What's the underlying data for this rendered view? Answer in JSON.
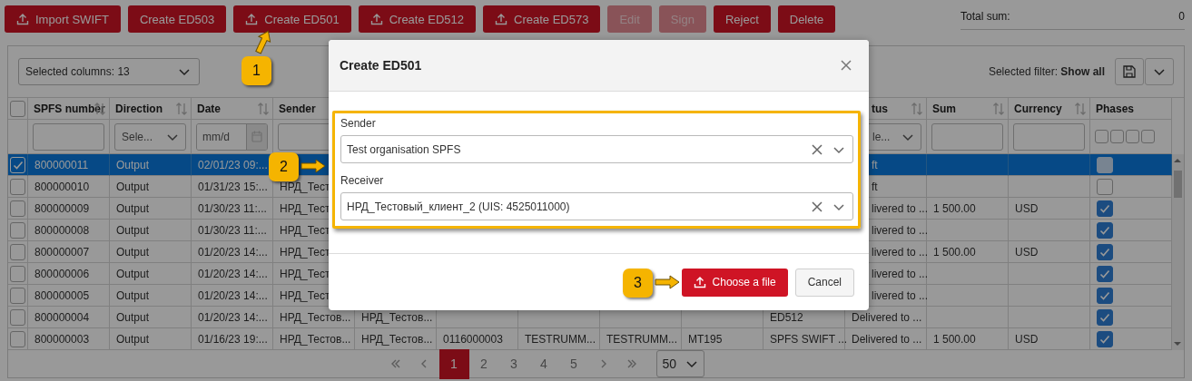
{
  "toolbar": {
    "buttons": [
      {
        "label": "Import SWIFT",
        "icon": true,
        "disabled": false
      },
      {
        "label": "Create ED503",
        "icon": false,
        "disabled": false
      },
      {
        "label": "Create ED501",
        "icon": true,
        "disabled": false
      },
      {
        "label": "Create ED512",
        "icon": true,
        "disabled": false
      },
      {
        "label": "Create ED573",
        "icon": true,
        "disabled": false
      },
      {
        "label": "Edit",
        "icon": false,
        "disabled": true
      },
      {
        "label": "Sign",
        "icon": false,
        "disabled": true
      },
      {
        "label": "Reject",
        "icon": false,
        "disabled": false
      },
      {
        "label": "Delete",
        "icon": false,
        "disabled": false
      }
    ],
    "total_sum": {
      "label": "Total sum:",
      "value": "0"
    }
  },
  "grid_controls": {
    "selected_columns": "Selected columns: 13",
    "selected_filter": "Selected filter: **Show all**"
  },
  "table": {
    "all_checked": false,
    "columns": [
      {
        "label": "SPFS number",
        "sortable": true,
        "filter": {
          "kind": "text"
        }
      },
      {
        "label": "Direction",
        "sortable": true,
        "filter": {
          "kind": "select",
          "value": "Sele..."
        }
      },
      {
        "label": "Date",
        "sortable": true,
        "filter": {
          "kind": "date",
          "placeholder": "mm/d"
        }
      },
      {
        "label": "Sender",
        "filter": {
          "kind": "text"
        }
      },
      {},
      {},
      {},
      {},
      {},
      {},
      {
        "label": "tus",
        "sortable": true,
        "filter": {
          "kind": "select",
          "value": "le..."
        }
      },
      {
        "label": "Sum",
        "sortable": true,
        "filter": {
          "kind": "text"
        }
      },
      {
        "label": "Currency",
        "sortable": true,
        "filter": {
          "kind": "text"
        }
      },
      {
        "label": "Phases",
        "sortable": false,
        "filter": {
          "kind": "phases",
          "boxes": [
            {
              "checked": false
            },
            {
              "checked": false
            },
            {
              "checked": false
            },
            {
              "checked": false
            }
          ]
        }
      }
    ],
    "rows": [
      {
        "selected": true,
        "checked": true,
        "phase_checked": false,
        "cells": [
          "800000011",
          "Output",
          "02/01/23 09:...",
          null,
          null,
          null,
          null,
          null,
          null,
          null,
          "ft",
          null,
          null
        ]
      },
      {
        "selected": false,
        "checked": false,
        "phase_checked": false,
        "cells": [
          "800000010",
          "Output",
          "01/31/23 15:...",
          "НРД_Тест",
          null,
          null,
          null,
          null,
          null,
          null,
          "ft",
          null,
          null
        ]
      },
      {
        "selected": false,
        "checked": false,
        "phase_checked": true,
        "cells": [
          "800000009",
          "Output",
          "01/30/23 11:...",
          "НРД_Тест",
          null,
          null,
          null,
          null,
          null,
          null,
          "livered to ...",
          "1 500.00",
          "USD"
        ]
      },
      {
        "selected": false,
        "checked": false,
        "phase_checked": true,
        "cells": [
          "800000008",
          "Output",
          "01/30/23 11:...",
          "НРД_Тест",
          null,
          null,
          null,
          null,
          null,
          null,
          "livered to ...",
          null,
          null
        ]
      },
      {
        "selected": false,
        "checked": false,
        "phase_checked": true,
        "cells": [
          "800000007",
          "Output",
          "01/20/23 14:...",
          "НРД_Тест",
          null,
          null,
          null,
          null,
          null,
          null,
          "livered to ...",
          "1 500.00",
          "USD"
        ]
      },
      {
        "selected": false,
        "checked": false,
        "phase_checked": true,
        "cells": [
          "800000006",
          "Output",
          "01/20/23 14:...",
          "НРД_Тест",
          null,
          null,
          null,
          null,
          null,
          null,
          "livered to ...",
          null,
          null
        ]
      },
      {
        "selected": false,
        "checked": false,
        "phase_checked": true,
        "cells": [
          "800000005",
          "Output",
          "01/20/23 14:...",
          "НРД_Тест",
          null,
          null,
          null,
          null,
          null,
          null,
          "livered to ...",
          null,
          null
        ]
      },
      {
        "selected": false,
        "checked": false,
        "phase_checked": true,
        "cells": [
          "800000004",
          "Output",
          "01/20/23 14:...",
          "НРД_Тестов...",
          "НРД_Тестов...",
          null,
          null,
          null,
          null,
          "ED512",
          "Delivered to ...",
          null,
          null
        ]
      },
      {
        "selected": false,
        "checked": false,
        "phase_checked": true,
        "cells": [
          "800000003",
          "Output",
          "01/16/23 19:...",
          "НРД_Тестов...",
          "НРД_Тестов...",
          "0116000003",
          "TESTRUMM...",
          "TESTRUMM...",
          "MT195",
          "SPFS SWIFT ...",
          "Delivered to ...",
          "1 500.00",
          "USD"
        ]
      }
    ]
  },
  "pager": {
    "pages": [
      {
        "label": "1",
        "selected": true
      },
      {
        "label": "2",
        "selected": false
      },
      {
        "label": "3",
        "selected": false
      },
      {
        "label": "4",
        "selected": false
      },
      {
        "label": "5",
        "selected": false
      }
    ],
    "page_size": "50"
  },
  "dialog": {
    "title": "Create ED501",
    "fields": [
      {
        "label": "Sender",
        "value": "Test organisation SPFS"
      },
      {
        "label": "Receiver",
        "value": "НРД_Тестовый_клиент_2 (UIS: 4525011000)"
      }
    ],
    "buttons": [
      {
        "label": "Choose a file",
        "kind": "primary"
      },
      {
        "label": "Cancel",
        "kind": "secondary"
      }
    ]
  },
  "callouts": [
    {
      "number": "1"
    },
    {
      "number": "2"
    },
    {
      "number": "3"
    }
  ]
}
